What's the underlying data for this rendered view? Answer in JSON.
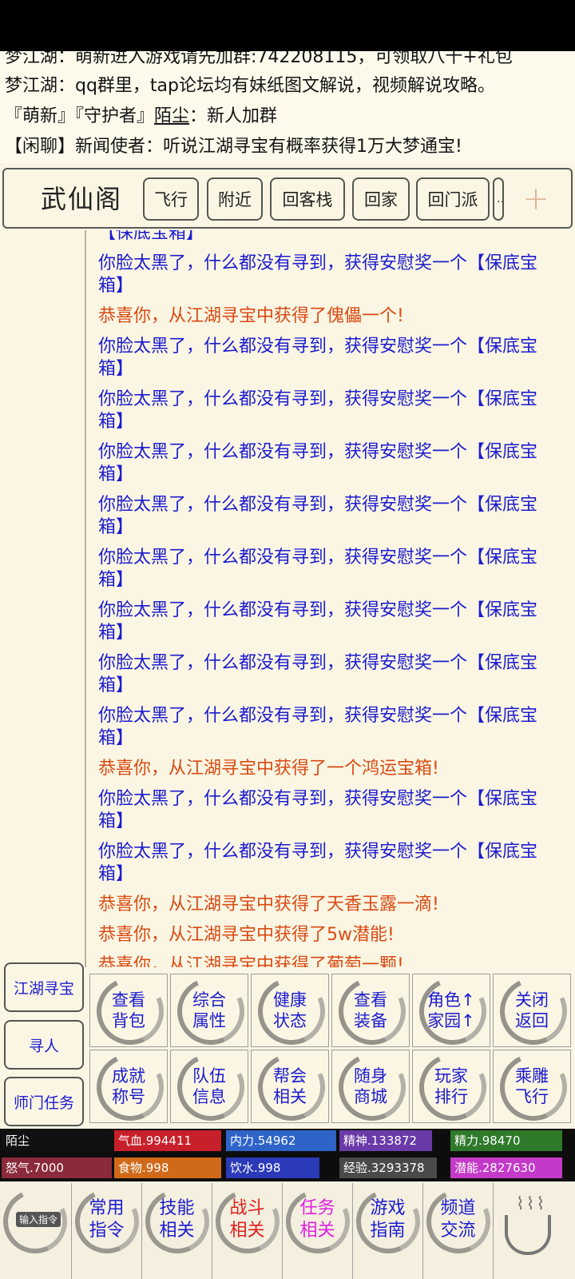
{
  "notices": {
    "line1": "梦江湖：萌新进入游戏请先加群:742208115，可领取八千+礼包",
    "line2": "梦江湖：qq群里，tap论坛均有妹纸图文解说，视频解说攻略。",
    "line3_prefix": "『萌新』『守护者』",
    "line3_name": "陌尘",
    "line3_suffix": "：新人加群",
    "line4": "【闲聊】新闻使者：听说江湖寻宝有概率获得1万大梦通宝!"
  },
  "location": {
    "name": "武仙阁",
    "buttons": [
      "飞行",
      "附近",
      "回客栈",
      "回家",
      "回门派",
      "…"
    ],
    "plus": "+"
  },
  "log": [
    {
      "text": "【保底宝箱】",
      "color": "blue"
    },
    {
      "text": "你脸太黑了，什么都没有寻到，获得安慰奖一个【保底宝箱】",
      "color": "blue"
    },
    {
      "text": "恭喜你，从江湖寻宝中获得了傀儡一个!",
      "color": "red"
    },
    {
      "text": "你脸太黑了，什么都没有寻到，获得安慰奖一个【保底宝箱】",
      "color": "blue"
    },
    {
      "text": "你脸太黑了，什么都没有寻到，获得安慰奖一个【保底宝箱】",
      "color": "blue"
    },
    {
      "text": "你脸太黑了，什么都没有寻到，获得安慰奖一个【保底宝箱】",
      "color": "blue"
    },
    {
      "text": "你脸太黑了，什么都没有寻到，获得安慰奖一个【保底宝箱】",
      "color": "blue"
    },
    {
      "text": "你脸太黑了，什么都没有寻到，获得安慰奖一个【保底宝箱】",
      "color": "blue"
    },
    {
      "text": "你脸太黑了，什么都没有寻到，获得安慰奖一个【保底宝箱】",
      "color": "blue"
    },
    {
      "text": "你脸太黑了，什么都没有寻到，获得安慰奖一个【保底宝箱】",
      "color": "blue"
    },
    {
      "text": "你脸太黑了，什么都没有寻到，获得安慰奖一个【保底宝箱】",
      "color": "blue"
    },
    {
      "text": "恭喜你，从江湖寻宝中获得了一个鸿运宝箱!",
      "color": "red"
    },
    {
      "text": "你脸太黑了，什么都没有寻到，获得安慰奖一个【保底宝箱】",
      "color": "blue"
    },
    {
      "text": "你脸太黑了，什么都没有寻到，获得安慰奖一个【保底宝箱】",
      "color": "blue"
    },
    {
      "text": "恭喜你，从江湖寻宝中获得了天香玉露一滴!",
      "color": "red"
    },
    {
      "text": "恭喜你，从江湖寻宝中获得了5w潜能!",
      "color": "red"
    },
    {
      "text": "恭喜你，从江湖寻宝中获得了葡萄一颗!",
      "color": "red"
    }
  ],
  "side_buttons": [
    "江湖寻宝",
    "寻人",
    "师门任务"
  ],
  "grid_buttons": [
    "查看\n背包",
    "综合\n属性",
    "健康\n状态",
    "查看\n装备",
    "角色↑\n家园↑",
    "关闭\n返回",
    "成就\n称号",
    "队伍\n信息",
    "帮会\n相关",
    "随身\n商城",
    "玩家\n排行",
    "乘雕\n飞行"
  ],
  "stats": {
    "name": "陌尘",
    "hp": "气血.994411",
    "mp": "内力.54962",
    "spirit": "精神.133872",
    "energy": "精力.98470",
    "rage": "怒气.7000",
    "food": "食物.998",
    "water": "饮水.998",
    "exp": "经验.3293378",
    "potential": "潜能.2827630"
  },
  "stat_levels": {
    "hp": 1.0,
    "mp": 1.0,
    "spirit": 0.85,
    "energy": 1.0,
    "rage": 1.0,
    "food": 1.0,
    "water": 0.85,
    "exp": 0.9,
    "potential": 1.0
  },
  "colors": {
    "hp": "#c8202a",
    "mp": "#2e64c8",
    "spirit": "#6a3aa8",
    "energy": "#2e7a2a",
    "rage": "#8a2a3a",
    "food": "#d06a1a",
    "water": "#2a3ab8",
    "exp": "#4a4a4a",
    "potential": "#c43ac8"
  },
  "bottom_nav": {
    "input_label": "输入指令",
    "items": [
      "常用\n指令",
      "技能\n相关",
      "战斗\n相关",
      "任务\n相关",
      "游戏\n指南",
      "频道\n交流"
    ]
  }
}
